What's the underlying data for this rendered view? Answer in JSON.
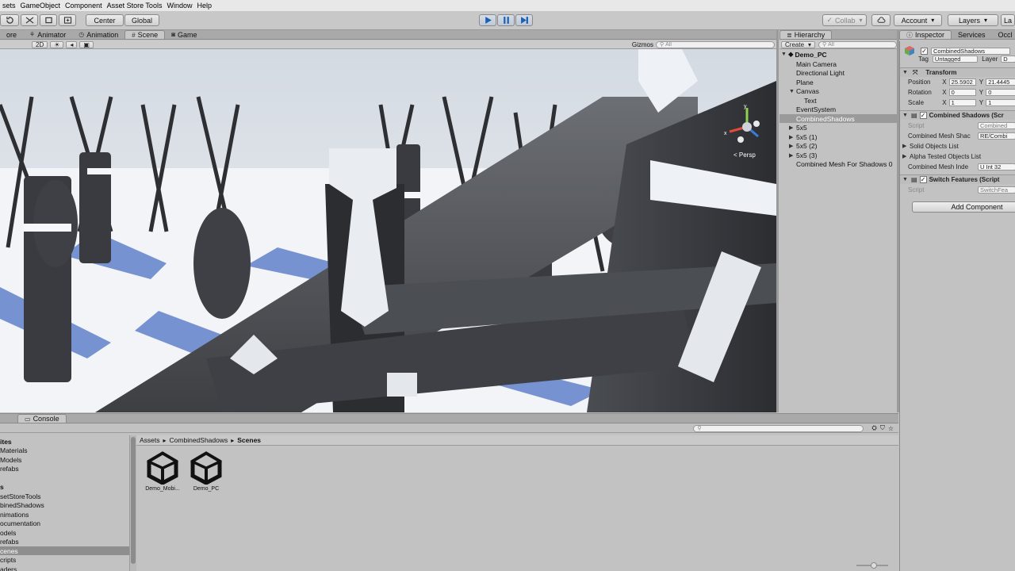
{
  "menubar": {
    "items": [
      "sets",
      "GameObject",
      "Component",
      "Asset Store Tools",
      "Window",
      "Help"
    ]
  },
  "toolbar": {
    "center_label": "Center",
    "global_label": "Global",
    "collab_label": "Collab",
    "account_label": "Account",
    "layers_label": "Layers",
    "layout_label": "La"
  },
  "scene_tabs": {
    "tabs": [
      "ore",
      "Animator",
      "Animation",
      "Scene",
      "Game"
    ],
    "active": "Scene",
    "mode_2d": "2D",
    "gizmos_label": "Gizmos",
    "search_placeholder": "All",
    "persp_label": "< Persp"
  },
  "hierarchy": {
    "tab_label": "Hierarchy",
    "create_label": "Create",
    "search_placeholder": "All",
    "scene_name": "Demo_PC",
    "items": [
      {
        "label": "Main Camera",
        "indent": 1,
        "expandable": false
      },
      {
        "label": "Directional Light",
        "indent": 1,
        "expandable": false
      },
      {
        "label": "Plane",
        "indent": 1,
        "expandable": false
      },
      {
        "label": "Canvas",
        "indent": 1,
        "expandable": true,
        "expanded": true
      },
      {
        "label": "Text",
        "indent": 2,
        "expandable": false
      },
      {
        "label": "EventSystem",
        "indent": 1,
        "expandable": false
      },
      {
        "label": "CombinedShadows",
        "indent": 1,
        "expandable": false,
        "selected": true
      },
      {
        "label": "5x5",
        "indent": 1,
        "expandable": true
      },
      {
        "label": "5x5 (1)",
        "indent": 1,
        "expandable": true
      },
      {
        "label": "5x5 (2)",
        "indent": 1,
        "expandable": true
      },
      {
        "label": "5x5 (3)",
        "indent": 1,
        "expandable": true
      },
      {
        "label": "Combined Mesh For Shadows 0",
        "indent": 1,
        "expandable": false
      }
    ]
  },
  "inspector": {
    "tabs": [
      "Inspector",
      "Services",
      "Occl"
    ],
    "object_name": "CombinedShadows",
    "tag_label": "Tag",
    "tag_value": "Untagged",
    "layer_label": "Layer",
    "layer_value": "D",
    "transform": {
      "title": "Transform",
      "position_label": "Position",
      "rotation_label": "Rotation",
      "scale_label": "Scale",
      "position": {
        "x": "25.5902",
        "y": "21.4445"
      },
      "rotation": {
        "x": "0",
        "y": "0"
      },
      "scale": {
        "x": "1",
        "y": "1"
      }
    },
    "combined_shadows": {
      "title": "Combined Shadows (Scr",
      "script_label": "Script",
      "script_value": "Combined",
      "mesh_shadows_label": "Combined Mesh Shac",
      "mesh_shadows_value": "RE/Combi",
      "solid_list_label": "Solid Objects List",
      "alpha_list_label": "Alpha Tested Objects List",
      "mesh_index_label": "Combined Mesh Inde",
      "mesh_index_value": "U Int 32"
    },
    "switch_features": {
      "title": "Switch Features (Script",
      "script_label": "Script",
      "script_value": "SwitchFea"
    },
    "add_component_label": "Add Component"
  },
  "bottom": {
    "tabs": [
      "Console"
    ],
    "breadcrumb": [
      "Assets",
      "CombinedShadows",
      "Scenes"
    ],
    "sidebar_items": [
      {
        "label": "ites",
        "bold": true
      },
      {
        "label": "Materials"
      },
      {
        "label": "Models"
      },
      {
        "label": "refabs"
      },
      {
        "label": ""
      },
      {
        "label": "s",
        "bold": true
      },
      {
        "label": "setStoreTools"
      },
      {
        "label": "binedShadows"
      },
      {
        "label": "nimations"
      },
      {
        "label": "ocumentation"
      },
      {
        "label": "odels"
      },
      {
        "label": "refabs"
      },
      {
        "label": "cenes",
        "selected": true
      },
      {
        "label": "cripts"
      },
      {
        "label": "aders"
      }
    ],
    "assets": [
      {
        "label": "Demo_Mobi..."
      },
      {
        "label": "Demo_PC"
      }
    ]
  }
}
